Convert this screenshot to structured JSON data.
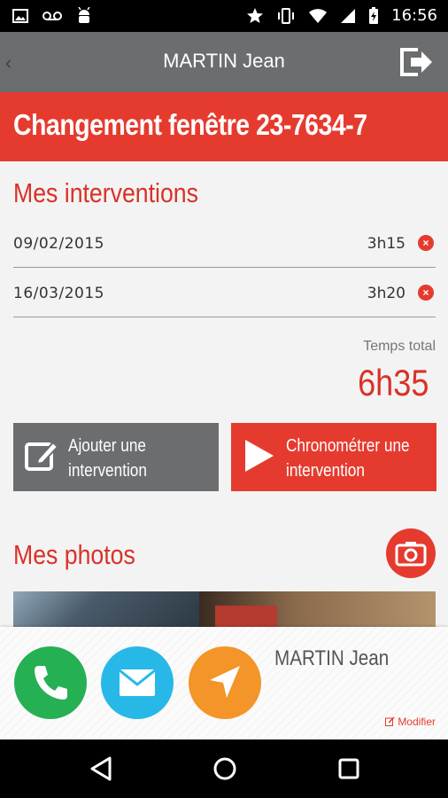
{
  "status_bar": {
    "time": "16:56"
  },
  "app_bar": {
    "title": "MARTIN Jean"
  },
  "job": {
    "title": "Changement fenêtre 23-7634-7"
  },
  "interventions": {
    "title": "Mes interventions",
    "rows": [
      {
        "date": "09/02/2015",
        "duration": "3h15"
      },
      {
        "date": "16/03/2015",
        "duration": "3h20"
      }
    ],
    "total_label": "Temps total",
    "total_value": "6h35"
  },
  "buttons": {
    "add_label_1": "Ajouter une",
    "add_label_2": "intervention",
    "timer_label_1": "Chronométrer une",
    "timer_label_2": "intervention"
  },
  "photos": {
    "title": "Mes photos"
  },
  "contact": {
    "name": "MARTIN Jean",
    "modify_label": "Modifier"
  },
  "colors": {
    "accent_red": "#e53b2f",
    "appbar_gray": "#6b6d6f",
    "call_green": "#25b053",
    "mail_blue": "#27b8e8",
    "nav_orange": "#f39528"
  }
}
